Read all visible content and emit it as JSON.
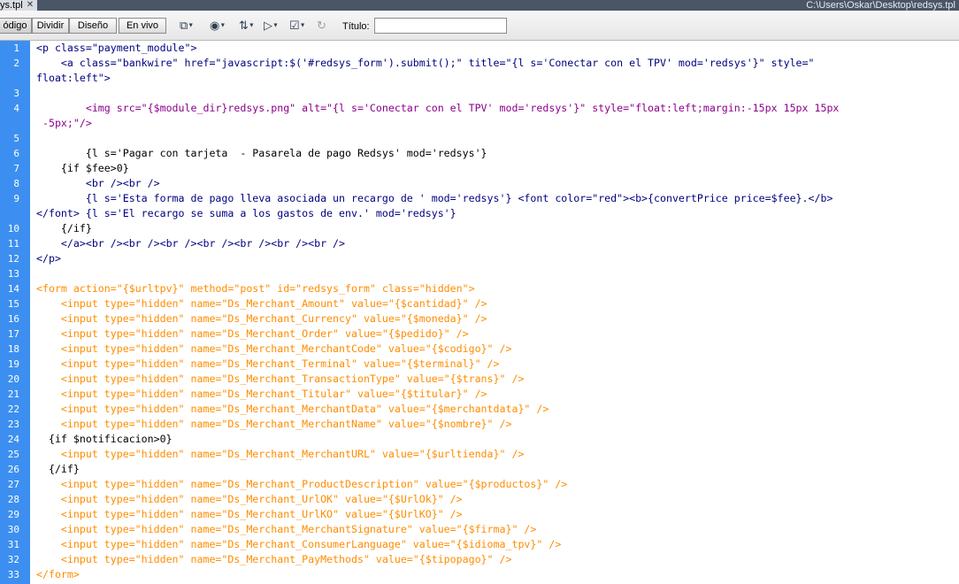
{
  "window": {
    "doc_tab": "ys.tpl",
    "path": "C:\\Users\\Oskar\\Desktop\\redsys.tpl"
  },
  "toolbar": {
    "view_buttons": [
      "ódigo",
      "Dividir",
      "Diseño",
      "En vivo"
    ],
    "title_label": "Título:",
    "title_value": ""
  },
  "code": {
    "line_numbers": [
      "1",
      "2",
      "3",
      "4",
      "5",
      "6",
      "7",
      "8",
      "9",
      "10",
      "11",
      "12",
      "13",
      "14",
      "15",
      "16",
      "17",
      "18",
      "19",
      "20",
      "21",
      "22",
      "23",
      "24",
      "25",
      "26",
      "27",
      "28",
      "29",
      "30",
      "31",
      "32",
      "33"
    ],
    "lines": [
      "<p class=\"payment_module\">",
      "    <a class=\"bankwire\" href=\"javascript:$('#redsys_form').submit();\" title=\"{l s='Conectar con el TPV' mod='redsys'}\" style=\"",
      "float:left\">",
      "",
      "        <img src=\"{$module_dir}redsys.png\" alt=\"{l s='Conectar con el TPV' mod='redsys'}\" style=\"float:left;margin:-15px 15px 15px",
      " -5px;\"/>",
      "",
      "        {l s='Pagar con tarjeta  - Pasarela de pago Redsys' mod='redsys'}",
      "    {if $fee>0}",
      "        <br /><br />",
      "        {l s='Esta forma de pago lleva asociada un recargo de ' mod='redsys'} <font color=\"red\"><b>{convertPrice price=$fee}.</b>",
      "</font> {l s='El recargo se suma a los gastos de env.' mod='redsys'}",
      "    {/if}",
      "    </a><br /><br /><br /><br /><br /><br /><br />",
      "</p>",
      "",
      "<form action=\"{$urltpv}\" method=\"post\" id=\"redsys_form\" class=\"hidden\">",
      "    <input type=\"hidden\" name=\"Ds_Merchant_Amount\" value=\"{$cantidad}\" />",
      "    <input type=\"hidden\" name=\"Ds_Merchant_Currency\" value=\"{$moneda}\" />",
      "    <input type=\"hidden\" name=\"Ds_Merchant_Order\" value=\"{$pedido}\" />",
      "    <input type=\"hidden\" name=\"Ds_Merchant_MerchantCode\" value=\"{$codigo}\" />",
      "    <input type=\"hidden\" name=\"Ds_Merchant_Terminal\" value=\"{$terminal}\" />",
      "    <input type=\"hidden\" name=\"Ds_Merchant_TransactionType\" value=\"{$trans}\" />",
      "    <input type=\"hidden\" name=\"Ds_Merchant_Titular\" value=\"{$titular}\" />",
      "    <input type=\"hidden\" name=\"Ds_Merchant_MerchantData\" value=\"{$merchantdata}\" />",
      "    <input type=\"hidden\" name=\"Ds_Merchant_MerchantName\" value=\"{$nombre}\" />",
      "  {if $notificacion>0}",
      "    <input type=\"hidden\" name=\"Ds_Merchant_MerchantURL\" value=\"{$urltienda}\" />",
      "  {/if}",
      "    <input type=\"hidden\" name=\"Ds_Merchant_ProductDescription\" value=\"{$productos}\" />",
      "    <input type=\"hidden\" name=\"Ds_Merchant_UrlOK\" value=\"{$UrlOk}\" />",
      "    <input type=\"hidden\" name=\"Ds_Merchant_UrlKO\" value=\"{$UrlKO}\" />",
      "    <input type=\"hidden\" name=\"Ds_Merchant_MerchantSignature\" value=\"{$firma}\" />",
      "    <input type=\"hidden\" name=\"Ds_Merchant_ConsumerLanguage\" value=\"{$idioma_tpv}\" />",
      "    <input type=\"hidden\" name=\"Ds_Merchant_PayMethods\" value=\"{$tipopago}\" />",
      "</form>"
    ]
  },
  "colors": {
    "gutter": "#3c8ff0",
    "tag_blue": "#000080",
    "value_blue": "#0000ff",
    "form_tag_orange": "#ff8c00",
    "title_bar": "#4a5566"
  },
  "icons": [
    "file-management-icon",
    "preview-browser-icon",
    "debug-icon",
    "visual-aids-icon",
    "validate-markup-icon",
    "refresh-icon"
  ]
}
